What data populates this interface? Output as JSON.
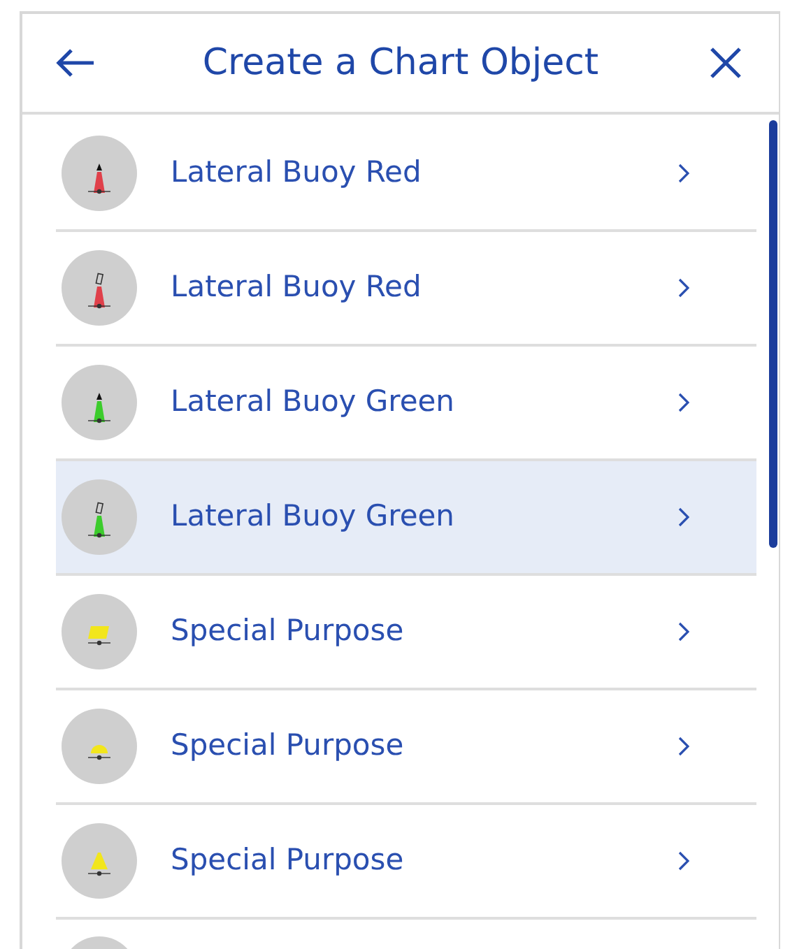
{
  "header": {
    "title": "Create a Chart Object"
  },
  "items": [
    {
      "label": "Lateral Buoy Red",
      "kind": "pillar-solid",
      "color": "#e0404a",
      "selected": false
    },
    {
      "label": "Lateral Buoy Red",
      "kind": "pillar-outline",
      "color": "#e0404a",
      "selected": false
    },
    {
      "label": "Lateral Buoy Green",
      "kind": "pillar-solid",
      "color": "#3ccc2c",
      "selected": false
    },
    {
      "label": "Lateral Buoy Green",
      "kind": "pillar-outline",
      "color": "#3ccc2c",
      "selected": true
    },
    {
      "label": "Special Purpose",
      "kind": "barrel",
      "color": "#f2e61c",
      "selected": false
    },
    {
      "label": "Special Purpose",
      "kind": "spherical",
      "color": "#f2e61c",
      "selected": false
    },
    {
      "label": "Special Purpose",
      "kind": "conical",
      "color": "#f2e61c",
      "selected": false
    }
  ]
}
